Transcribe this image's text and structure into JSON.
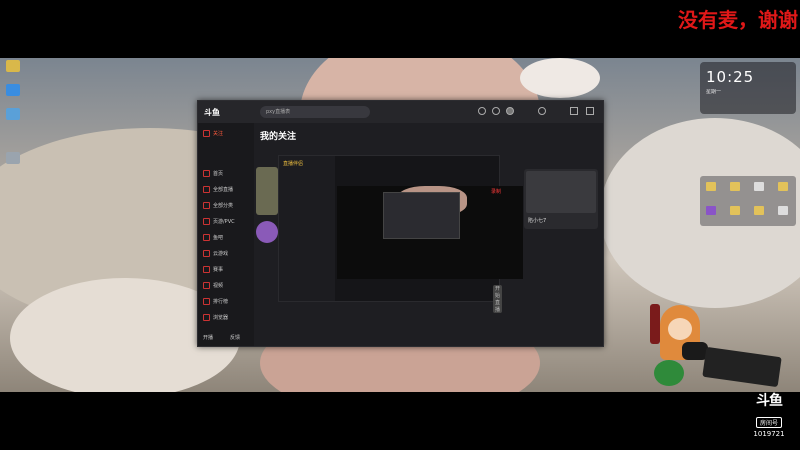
{
  "caption": "没有麦，谢谢",
  "clock": {
    "time": "10:25",
    "date": "星期一"
  },
  "app": {
    "logo": "斗鱼",
    "search_placeholder": "pxy直播表",
    "main_title": "我的关注",
    "sidebar_items": [
      {
        "label": "关注",
        "active": true
      },
      {
        "label": "首页"
      },
      {
        "label": "全部直播"
      },
      {
        "label": "全部分类"
      },
      {
        "label": "页游/PVC"
      },
      {
        "label": "鱼吧"
      },
      {
        "label": "云游戏"
      },
      {
        "label": "赛事"
      },
      {
        "label": "视频"
      },
      {
        "label": "排行榜"
      },
      {
        "label": "浏览器"
      }
    ],
    "sidebar_footer": [
      "开播",
      "反馈"
    ],
    "card_title": "陷小七7",
    "inner_logo": "直播伴侣",
    "recording_label": "录制",
    "go_live": "开始直播"
  },
  "watermark": {
    "logo": "斗鱼",
    "room_label": "房间号",
    "room_number": "1019721"
  },
  "colors": {
    "accent": "#ff5a3c",
    "caption": "#e01818",
    "window_bg": "#1e1e22"
  }
}
